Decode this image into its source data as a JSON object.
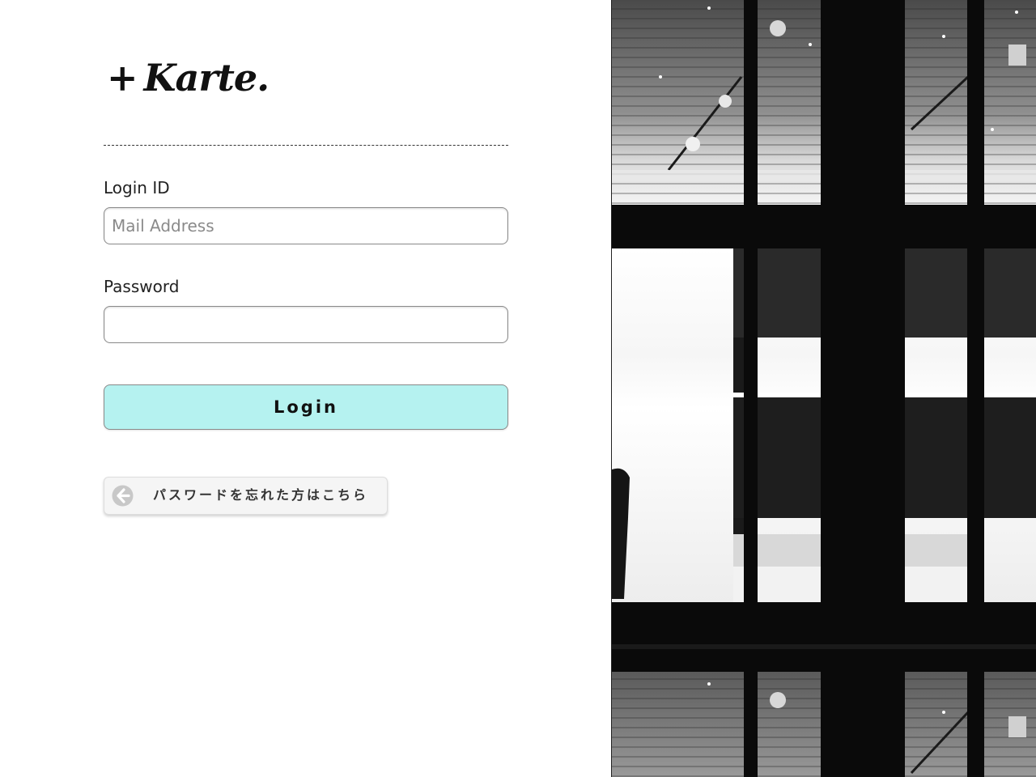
{
  "brand": {
    "logo_text": "Karte.",
    "logo_prefix": "+"
  },
  "login_form": {
    "login_id_label": "Login ID",
    "login_id_placeholder": "Mail Address",
    "login_id_value": "",
    "password_label": "Password",
    "password_value": "",
    "login_button_label": "Login",
    "login_button_color": "#b5f2f0"
  },
  "forgot_password": {
    "label": "パスワードを忘れた方はこちら",
    "icon": "arrow-left-circle-icon"
  },
  "side_image": {
    "subject": "black-and-white photo of building windows"
  }
}
